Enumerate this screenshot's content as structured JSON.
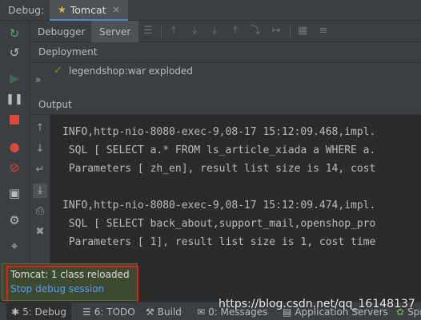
{
  "titlebar": {
    "debug_label": "Debug:",
    "session_tab": "Tomcat"
  },
  "toolbar": {
    "tabs": [
      "Debugger",
      "Server"
    ],
    "active_tab": "Server"
  },
  "deployment": {
    "header": "Deployment",
    "artifact": "legendshop:war exploded",
    "artifact_status_color": "#5aa83a"
  },
  "output": {
    "header": "Output",
    "lines": [
      "INFO,http-nio-8080-exec-9,08-17 15:12:09.468,impl.",
      " SQL [ SELECT a.* FROM ls_article_xiada a WHERE a.",
      " Parameters [ zh_en], result list size is 14, cost",
      "",
      "INFO,http-nio-8080-exec-9,08-17 15:12:09.474,impl.",
      " SQL [ SELECT back_about,support_mail,openshop_pro",
      " Parameters [ 1], result list size is 1, cost time"
    ]
  },
  "notification": {
    "message": "Tomcat: 1 class reloaded",
    "link": "Stop debug session",
    "highlight_color": "#e01e1e"
  },
  "statusbar": {
    "items": [
      {
        "icon": "bug-icon",
        "label": "5: Debug"
      },
      {
        "icon": "todo-icon",
        "label": "6: TODO"
      },
      {
        "icon": "hammer-icon",
        "label": "Build"
      },
      {
        "icon": "messages-icon",
        "label": "0: Messages"
      },
      {
        "icon": "server-icon",
        "label": "Application Servers"
      },
      {
        "icon": "spring-icon",
        "label": "Spr"
      }
    ]
  },
  "watermark": "https://blog.csdn.net/qq_16148137",
  "colors": {
    "background": "#2b2b2b",
    "panel": "#3c3f41",
    "accent": "#4a88c7",
    "link": "#589df6"
  }
}
